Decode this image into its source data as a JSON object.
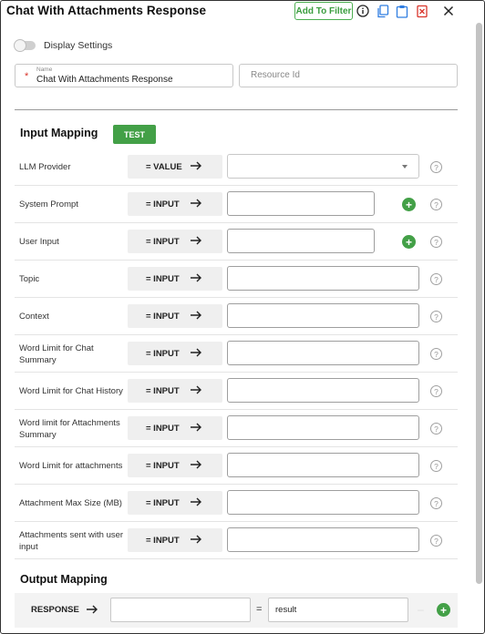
{
  "header": {
    "title": "Chat With Attachments Response",
    "add_to_filter_label": "Add To Filter",
    "icons": [
      "info-icon",
      "copy-icon",
      "paste-icon",
      "delete-icon",
      "close-icon"
    ],
    "accent_color": "#43a047",
    "danger_color": "#d9342b",
    "icon_color": "#2f7de1"
  },
  "display_settings": {
    "label": "Display Settings",
    "enabled": false
  },
  "fields": {
    "name": {
      "label": "Name",
      "value": "Chat With Attachments Response",
      "required": true
    },
    "resource_id": {
      "placeholder": "Resource Id",
      "value": ""
    }
  },
  "input_mapping": {
    "title": "Input Mapping",
    "test_label": "TEST",
    "rows": [
      {
        "label": "LLM Provider",
        "mapping": "= VALUE",
        "kind": "select",
        "add": false
      },
      {
        "label": "System Prompt",
        "mapping": "= INPUT",
        "kind": "input",
        "add": true
      },
      {
        "label": "User Input",
        "mapping": "= INPUT",
        "kind": "input",
        "add": true
      },
      {
        "label": "Topic",
        "mapping": "= INPUT",
        "kind": "input",
        "add": false
      },
      {
        "label": "Context",
        "mapping": "= INPUT",
        "kind": "input",
        "add": false
      },
      {
        "label": "Word Limit for Chat Summary",
        "mapping": "= INPUT",
        "kind": "input",
        "add": false
      },
      {
        "label": "Word Limit for Chat History",
        "mapping": "= INPUT",
        "kind": "input",
        "add": false
      },
      {
        "label": "Word limit for Attachments Summary",
        "mapping": "= INPUT",
        "kind": "input",
        "add": false
      },
      {
        "label": "Word Limit for attachments",
        "mapping": "= INPUT",
        "kind": "input",
        "add": false
      },
      {
        "label": "Attachment Max Size (MB)",
        "mapping": "= INPUT",
        "kind": "input",
        "add": false
      },
      {
        "label": "Attachments sent with user input",
        "mapping": "= INPUT",
        "kind": "input",
        "add": false
      }
    ]
  },
  "output_mapping": {
    "title": "Output Mapping",
    "label": "RESPONSE",
    "left_value": "",
    "equals": "=",
    "right_value": "result"
  }
}
